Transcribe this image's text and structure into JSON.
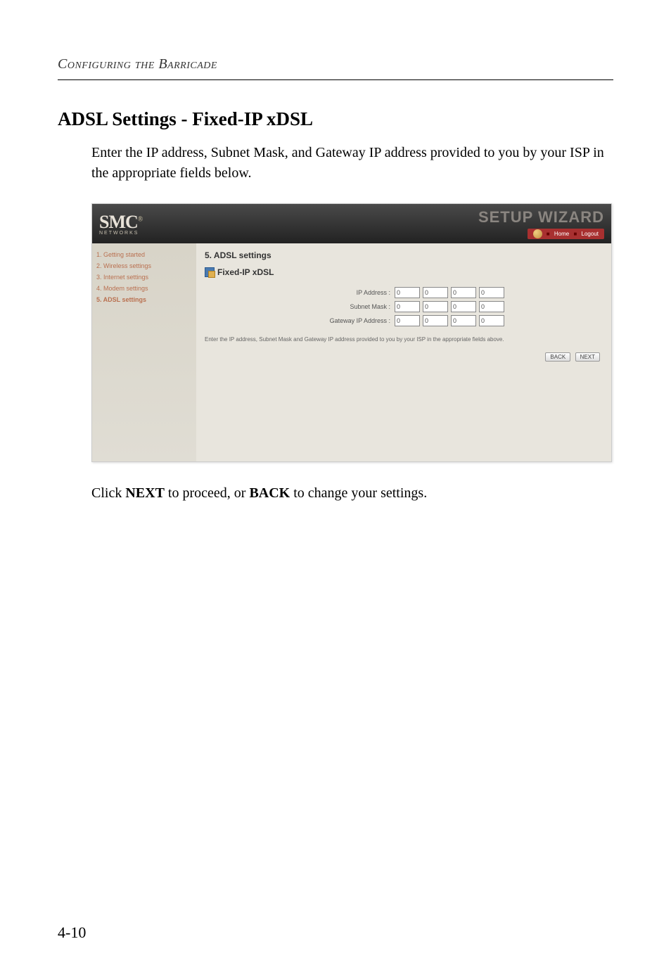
{
  "running_header": "Configuring the Barricade",
  "section_title": "ADSL Settings - Fixed-IP xDSL",
  "intro": "Enter the IP address, Subnet Mask, and Gateway IP address provided to you by your ISP in the appropriate fields below.",
  "screenshot": {
    "logo": "SMC",
    "logo_sub": "Networks",
    "wizard_title": "SETUP WIZARD",
    "top_buttons": {
      "home": "Home",
      "logout": "Logout"
    },
    "sidebar": {
      "items": [
        "1. Getting started",
        "2. Wireless settings",
        "3. Internet settings",
        "4. Modem settings",
        "5. ADSL settings"
      ]
    },
    "step_title": "5. ADSL settings",
    "subtitle": "Fixed-IP xDSL",
    "form": {
      "rows": [
        {
          "label": "IP Address :",
          "values": [
            "0",
            "0",
            "0",
            "0"
          ]
        },
        {
          "label": "Subnet Mask :",
          "values": [
            "0",
            "0",
            "0",
            "0"
          ]
        },
        {
          "label": "Gateway IP Address :",
          "values": [
            "0",
            "0",
            "0",
            "0"
          ]
        }
      ]
    },
    "hint": "Enter the IP address, Subnet Mask and Gateway IP address provided to you by your ISP in the appropriate fields above.",
    "buttons": {
      "back": "BACK",
      "next": "NEXT"
    }
  },
  "outro_prefix": "Click ",
  "outro_next": "NEXT",
  "outro_mid": " to proceed, or ",
  "outro_back": "BACK",
  "outro_suffix": " to change your settings.",
  "page_number": "4-10"
}
